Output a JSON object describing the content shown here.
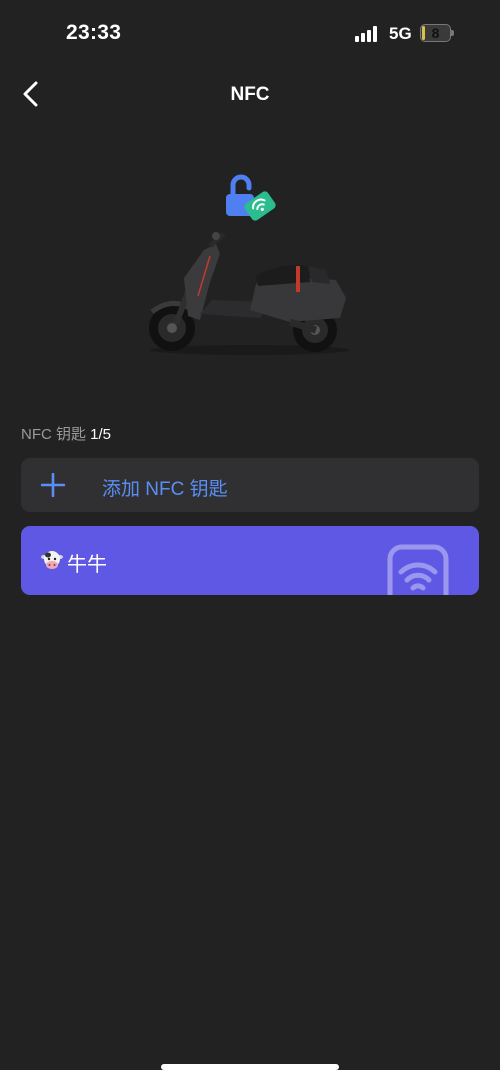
{
  "status_bar": {
    "time": "23:33",
    "network": "5G",
    "battery_level": "8",
    "battery_fraction": 0.08,
    "battery_color": "#d6c24a"
  },
  "nav": {
    "title": "NFC",
    "back_icon": "chevron-left-icon"
  },
  "hero": {
    "lock_icon": "unlocked-padlock-icon",
    "badge_icon": "nfc-card-icon",
    "image": "electric-scooter"
  },
  "keys_section": {
    "label": "NFC 钥匙",
    "count": "1/5"
  },
  "add_key": {
    "icon": "plus-icon",
    "label": "添加 NFC 钥匙",
    "accent": "#5a8ef5"
  },
  "keys": [
    {
      "emoji_icon": "cow-face-icon",
      "name": "牛牛",
      "card_color": "#5f58e4"
    }
  ],
  "colors": {
    "background": "#222222",
    "surface": "#303033"
  }
}
